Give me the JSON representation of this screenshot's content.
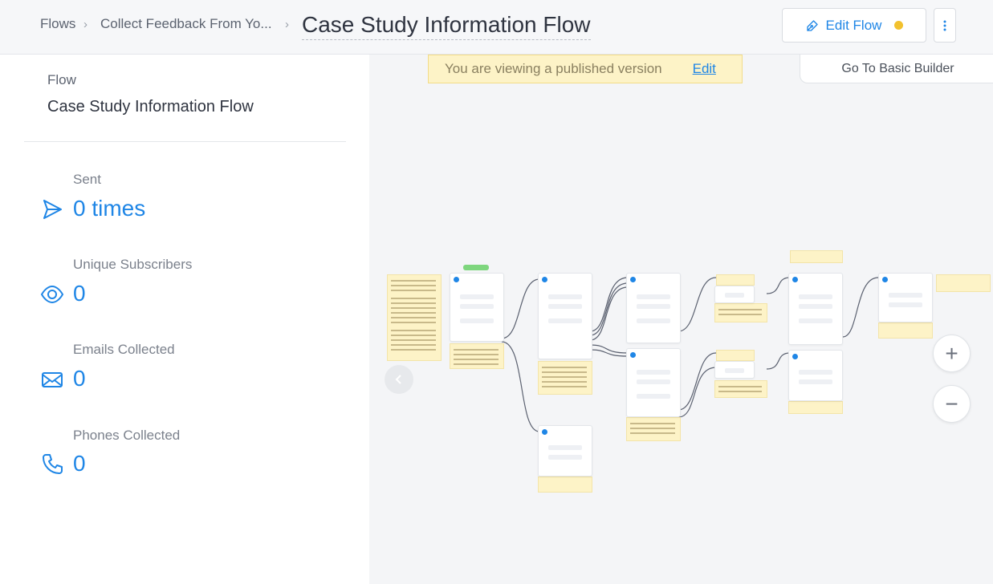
{
  "breadcrumb": {
    "items": [
      "Flows",
      "Collect Feedback From Yo..."
    ],
    "current": "Case Study Information Flow"
  },
  "header": {
    "edit_label": "Edit Flow",
    "status_color": "#f2c12e"
  },
  "sidebar": {
    "flow_label": "Flow",
    "flow_name": "Case Study Information Flow",
    "stats": [
      {
        "label": "Sent",
        "value": "0 times",
        "icon": "send-icon"
      },
      {
        "label": "Unique Subscribers",
        "value": "0",
        "icon": "eye-icon"
      },
      {
        "label": "Emails Collected",
        "value": "0",
        "icon": "mail-icon"
      },
      {
        "label": "Phones Collected",
        "value": "0",
        "icon": "phone-icon"
      }
    ]
  },
  "canvas": {
    "banner_text": "You are viewing a published version",
    "banner_edit": "Edit",
    "basic_builder": "Go To Basic Builder",
    "zoom_in": "+",
    "zoom_out": "−"
  },
  "colors": {
    "accent": "#1f86e6",
    "banner_bg": "#fdf3c7"
  }
}
